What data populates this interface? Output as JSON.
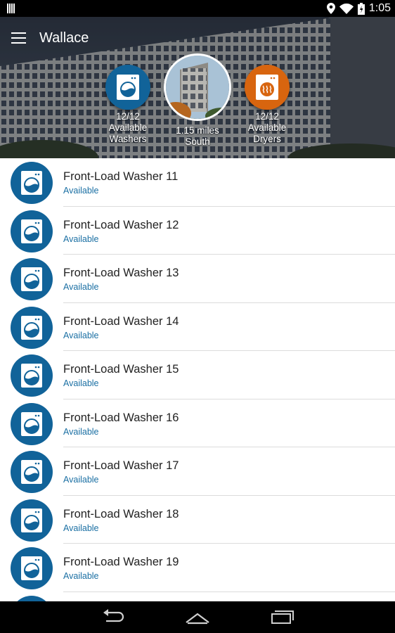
{
  "status_bar": {
    "time": "1:05"
  },
  "header": {
    "title": "Wallace",
    "washers": {
      "count": "12/12",
      "line1": "Available",
      "line2": "Washers"
    },
    "location": {
      "distance": "1.15 miles",
      "direction": "South"
    },
    "dryers": {
      "count": "12/12",
      "line1": "Available",
      "line2": "Dryers"
    },
    "colors": {
      "washer_blue": "#116399",
      "dryer_orange": "#d8650f"
    }
  },
  "list": {
    "items": [
      {
        "name": "Front-Load Washer 11",
        "status": "Available"
      },
      {
        "name": "Front-Load Washer 12",
        "status": "Available"
      },
      {
        "name": "Front-Load Washer 13",
        "status": "Available"
      },
      {
        "name": "Front-Load Washer 14",
        "status": "Available"
      },
      {
        "name": "Front-Load Washer 15",
        "status": "Available"
      },
      {
        "name": "Front-Load Washer 16",
        "status": "Available"
      },
      {
        "name": "Front-Load Washer 17",
        "status": "Available"
      },
      {
        "name": "Front-Load Washer 18",
        "status": "Available"
      },
      {
        "name": "Front-Load Washer 19",
        "status": "Available"
      },
      {
        "name": "",
        "status": ""
      }
    ]
  },
  "nav": {
    "back_icon": "back-icon",
    "home_icon": "home-icon",
    "recents_icon": "recents-icon"
  }
}
